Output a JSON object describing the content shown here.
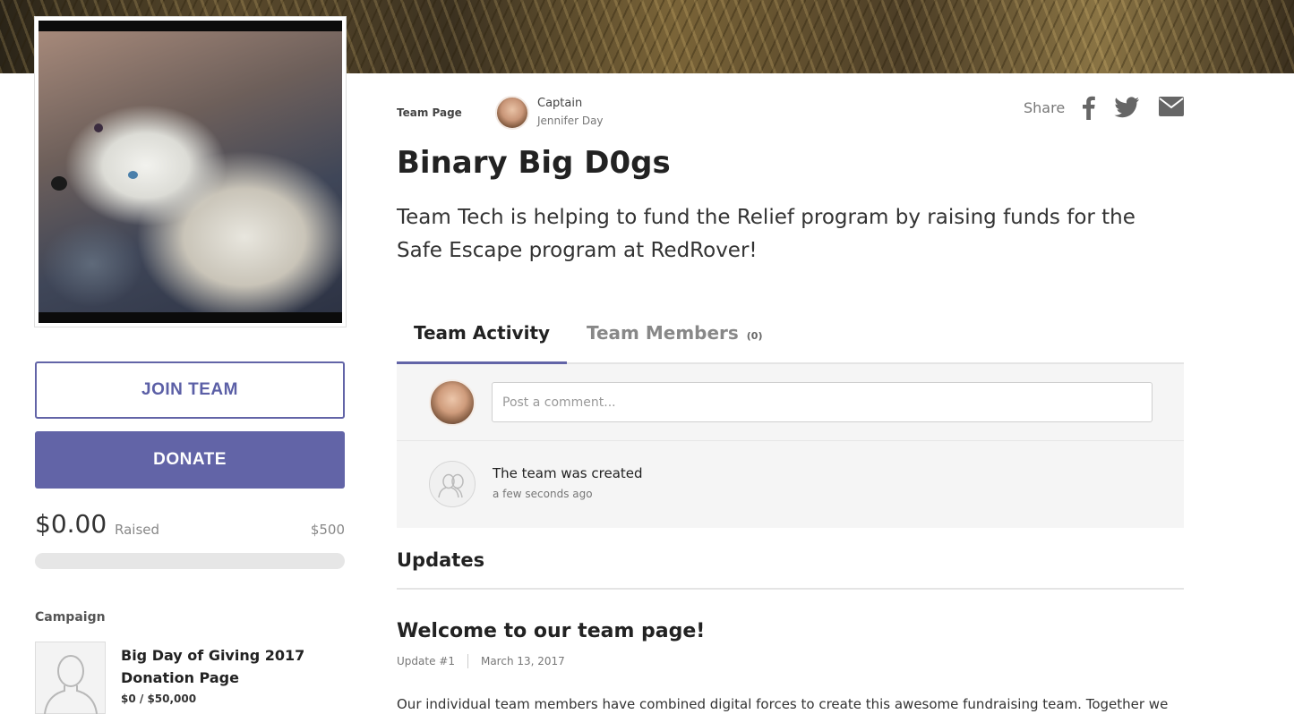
{
  "header": {
    "team_page_label": "Team Page",
    "captain_role": "Captain",
    "captain_name": "Jennifer Day",
    "share_label": "Share"
  },
  "team": {
    "title": "Binary Big D0gs",
    "description": "Team Tech is helping to fund the Relief program by raising funds for the Safe Escape program at RedRover!"
  },
  "actions": {
    "join_label": "JOIN TEAM",
    "donate_label": "DONATE"
  },
  "fundraising": {
    "raised_amount": "$0.00",
    "raised_label": "Raised",
    "goal": "$500",
    "progress_fraction": 0
  },
  "campaign": {
    "heading": "Campaign",
    "title": "Big Day of Giving 2017 Donation Page",
    "progress_text": "$0 / $50,000"
  },
  "tabs": {
    "activity": "Team Activity",
    "members": "Team Members",
    "members_count": "(0)"
  },
  "activity": {
    "comment_placeholder": "Post a comment...",
    "event_text": "The team was created",
    "event_time": "a few seconds ago"
  },
  "updates": {
    "heading": "Updates",
    "post_title": "Welcome to our team page!",
    "post_number": "Update #1",
    "post_date": "March 13, 2017",
    "post_body": "Our individual team members have combined digital forces to create this awesome fundraising team. Together we"
  },
  "icons": {
    "facebook": "facebook-icon",
    "twitter": "twitter-icon",
    "email": "email-icon",
    "team": "team-icon",
    "user": "user-placeholder-icon"
  },
  "colors": {
    "accent": "#6264a7",
    "text": "#222222",
    "muted": "#888888",
    "panel": "#f5f5f5"
  }
}
